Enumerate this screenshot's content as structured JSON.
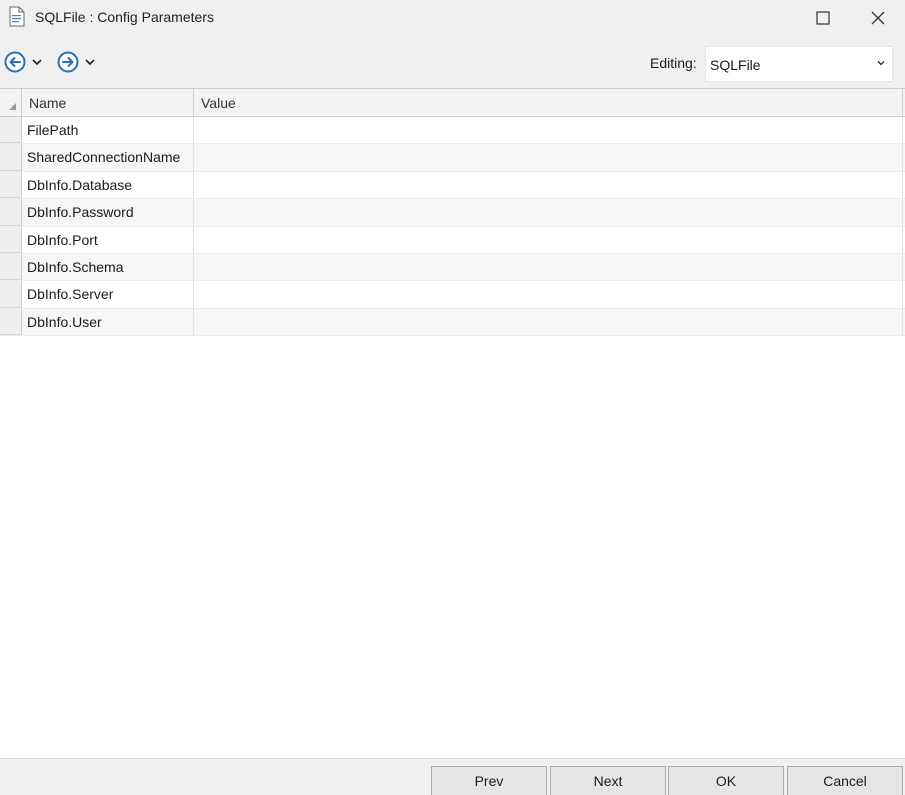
{
  "window": {
    "title": "SQLFile : Config Parameters"
  },
  "toolbar": {
    "editing_label": "Editing:",
    "editing_value": "SQLFile"
  },
  "grid": {
    "columns": [
      "Name",
      "Value"
    ],
    "rows": [
      {
        "name": "FilePath",
        "value": ""
      },
      {
        "name": "SharedConnectionName",
        "value": ""
      },
      {
        "name": "DbInfo.Database",
        "value": ""
      },
      {
        "name": "DbInfo.Password",
        "value": ""
      },
      {
        "name": "DbInfo.Port",
        "value": ""
      },
      {
        "name": "DbInfo.Schema",
        "value": ""
      },
      {
        "name": "DbInfo.Server",
        "value": ""
      },
      {
        "name": "DbInfo.User",
        "value": ""
      }
    ]
  },
  "footer": {
    "prev": "Prev",
    "next": "Next",
    "ok": "OK",
    "cancel": "Cancel"
  },
  "icons": {
    "app": "document-icon",
    "back": "back-circle-icon",
    "forward": "forward-circle-icon",
    "dropdown": "chevron-down-icon",
    "maximize": "maximize-icon",
    "close": "close-icon"
  },
  "colors": {
    "nav_icon": "#2f6db5",
    "chrome": "#f0f0f0"
  }
}
